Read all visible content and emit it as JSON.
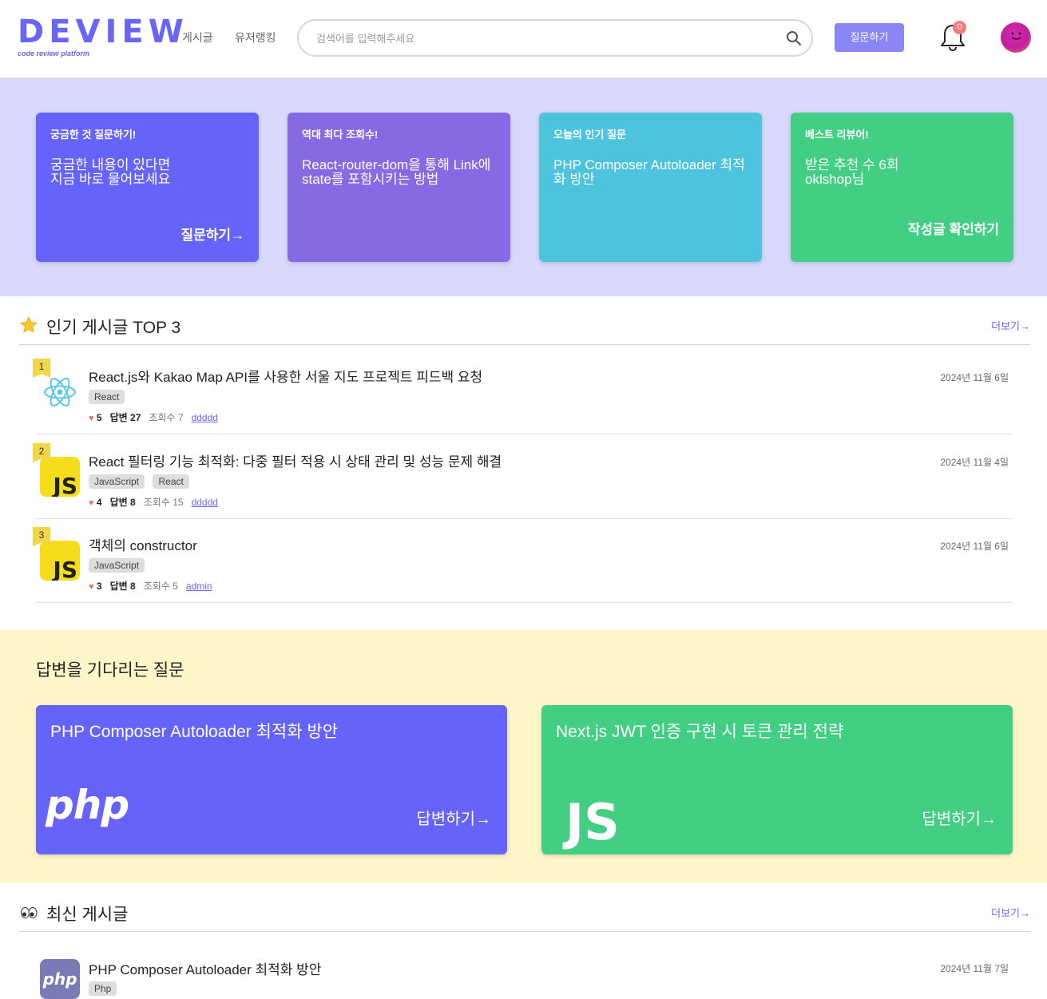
{
  "header": {
    "logo": "DEVIEW",
    "logo_sub": "code review platform",
    "nav": [
      "게시글",
      "유저랭킹"
    ],
    "search_placeholder": "검색어를 입력해주세요",
    "ask_label": "질문하기",
    "notification_count": "0"
  },
  "hero": [
    {
      "top": "궁금한 것 질문하기!",
      "body": "궁금한 내용이 있다면 지금 바로 물어보세요",
      "cta": "질문하기→",
      "color": "#6563fa"
    },
    {
      "top": "역대 최다 조회수!",
      "body": "React-router-dom을 통해 Link에 state를 포함시키는 방법",
      "cta": "",
      "color": "#866ae3"
    },
    {
      "top": "오늘의 인기 질문",
      "body": "PHP Composer Autoloader 최적화 방안",
      "cta": "",
      "color": "#4dc3dd"
    },
    {
      "top": "베스트 리뷰어!",
      "body": "받은 추천 수 6회 oklshop님",
      "cta": "작성글 확인하기",
      "color": "#43cf83"
    }
  ],
  "popular": {
    "title": "인기 게시글 TOP 3",
    "more": "더보기→",
    "posts": [
      {
        "rank": "1",
        "title": "React.js와 Kakao Map API를 사용한 서울 지도 프로젝트 피드백 요청",
        "tags": [
          "React"
        ],
        "likes": "5",
        "answers_label": "답변",
        "answers": "27",
        "views_label": "조회수",
        "views": "7",
        "author": "ddddd",
        "date": "2024년 11월 6일",
        "icon": "react-icon"
      },
      {
        "rank": "2",
        "title": "React 필터링 기능 최적화: 다중 필터 적용 시 상태 관리 및 성능 문제 해결",
        "tags": [
          "JavaScript",
          "React"
        ],
        "likes": "4",
        "answers_label": "답변",
        "answers": "8",
        "views_label": "조회수",
        "views": "15",
        "author": "ddddd",
        "date": "2024년 11월 4일",
        "icon": "js-icon"
      },
      {
        "rank": "3",
        "title": "객체의 constructor",
        "tags": [
          "JavaScript"
        ],
        "likes": "3",
        "answers_label": "답변",
        "answers": "8",
        "views_label": "조회수",
        "views": "5",
        "author": "admin",
        "date": "2024년 11월 6일",
        "icon": "js-icon"
      }
    ]
  },
  "waiting": {
    "title": "답변을 기다리는 질문",
    "cards": [
      {
        "title": "PHP Composer Autoloader 최적화 방안",
        "logo": "php",
        "cta": "답변하기→",
        "color": "#6563fa"
      },
      {
        "title": "Next.js JWT 인증 구현 시 토큰 관리 전략",
        "logo": "JS",
        "cta": "답변하기→",
        "color": "#43cf83"
      }
    ]
  },
  "latest": {
    "title": "최신 게시글",
    "more": "더보기→",
    "posts": [
      {
        "title": "PHP Composer Autoloader 최적화 방안",
        "tags": [
          "Php"
        ],
        "date": "2024년 11월 7일",
        "logo": "php",
        "icon": "php-icon"
      }
    ]
  }
}
